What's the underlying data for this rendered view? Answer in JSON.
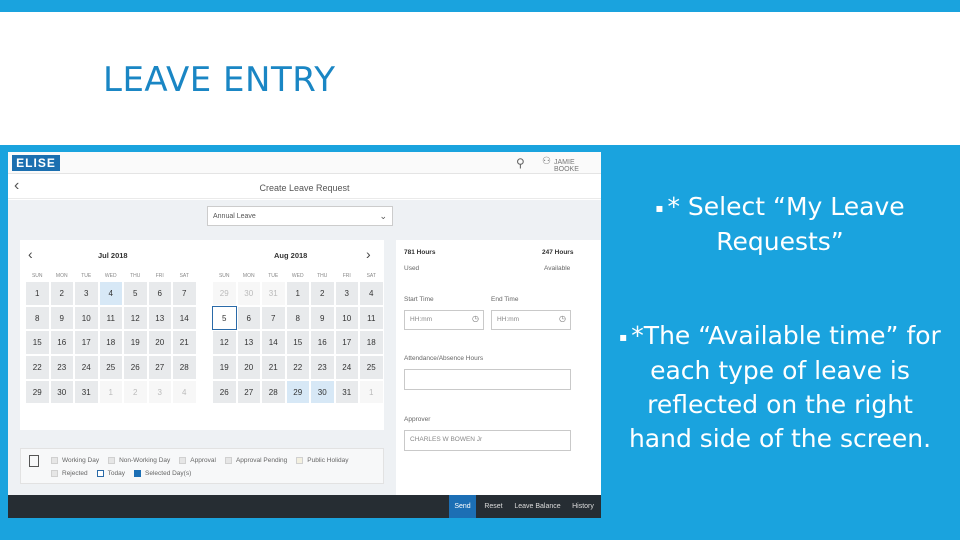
{
  "slide": {
    "title": "LEAVE ENTRY",
    "bullets": [
      "* Select “My Leave Requests”",
      "*The “Available time” for each type of leave is reflected on the right hand side of the screen."
    ]
  },
  "colors": {
    "accent": "#1aa3de",
    "title": "#1a86c4",
    "footer": "#262d33",
    "active_button": "#1c6fb5"
  },
  "app": {
    "logo": "ELISE",
    "user_name": "JAMIE BOOKE",
    "page_title": "Create Leave Request",
    "leave_type": "Annual Leave",
    "calendar": {
      "weekday_labels": [
        "SUN",
        "MON",
        "TUE",
        "WED",
        "THU",
        "FRI",
        "SAT"
      ],
      "months": [
        {
          "name": "Jul 2018",
          "days": [
            [
              "1",
              "2",
              "3",
              "4",
              "5",
              "6",
              "7"
            ],
            [
              "8",
              "9",
              "10",
              "11",
              "12",
              "13",
              "14"
            ],
            [
              "15",
              "16",
              "17",
              "18",
              "19",
              "20",
              "21"
            ],
            [
              "22",
              "23",
              "24",
              "25",
              "26",
              "27",
              "28"
            ],
            [
              "29",
              "30",
              "31",
              "1",
              "2",
              "3",
              "4"
            ]
          ]
        },
        {
          "name": "Aug 2018",
          "days": [
            [
              "29",
              "30",
              "31",
              "1",
              "2",
              "3",
              "4"
            ],
            [
              "5",
              "6",
              "7",
              "8",
              "9",
              "10",
              "11"
            ],
            [
              "12",
              "13",
              "14",
              "15",
              "16",
              "17",
              "18"
            ],
            [
              "19",
              "20",
              "21",
              "22",
              "23",
              "24",
              "25"
            ],
            [
              "26",
              "27",
              "28",
              "29",
              "30",
              "31",
              "1"
            ]
          ]
        }
      ]
    },
    "legend": [
      "Working Day",
      "Non-Working Day",
      "Approval",
      "Approval Pending",
      "Public Holiday",
      "Rejected",
      "Today",
      "Selected Day(s)"
    ],
    "summary": {
      "used_hours": "781 Hours",
      "used_label": "Used",
      "available_hours": "247 Hours",
      "available_label": "Available"
    },
    "form": {
      "start_time_label": "Start Time",
      "end_time_label": "End Time",
      "time_placeholder": "HH:mm",
      "hours_label": "Attendance/Absence Hours",
      "approver_label": "Approver",
      "approver_value": "CHARLES W BOWEN Jr"
    },
    "footer_buttons": [
      "Send",
      "Reset",
      "Leave Balance",
      "History"
    ]
  }
}
